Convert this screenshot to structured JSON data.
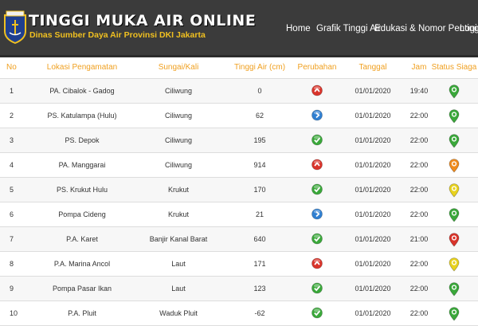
{
  "header": {
    "title": "TINGGI MUKA AIR ONLINE",
    "subtitle": "Dinas Sumber Daya Air Provinsi DKI Jakarta",
    "nav": [
      "Home",
      "Grafik Tinggi Air",
      "Edukasi & Nomor Penting",
      "Login"
    ]
  },
  "table": {
    "columns": [
      "No",
      "Lokasi Pengamatan",
      "Sungai/Kali",
      "Tinggi Air (cm)",
      "Perubahan",
      "Tanggal",
      "Jam",
      "Status Siaga"
    ],
    "rows": [
      {
        "no": "1",
        "lokasi": "PA. Cibalok - Gadog",
        "sungai": "Ciliwung",
        "tinggi": "0",
        "perubahan": "up",
        "tanggal": "01/01/2020",
        "jam": "19:40",
        "status": "normal"
      },
      {
        "no": "2",
        "lokasi": "PS. Katulampa (Hulu)",
        "sungai": "Ciliwung",
        "tinggi": "62",
        "perubahan": "steady",
        "tanggal": "01/01/2020",
        "jam": "22:00",
        "status": "normal"
      },
      {
        "no": "3",
        "lokasi": "PS. Depok",
        "sungai": "Ciliwung",
        "tinggi": "195",
        "perubahan": "down",
        "tanggal": "01/01/2020",
        "jam": "22:00",
        "status": "normal"
      },
      {
        "no": "4",
        "lokasi": "PA. Manggarai",
        "sungai": "Ciliwung",
        "tinggi": "914",
        "perubahan": "up",
        "tanggal": "01/01/2020",
        "jam": "22:00",
        "status": "siaga-2"
      },
      {
        "no": "5",
        "lokasi": "PS. Krukut Hulu",
        "sungai": "Krukut",
        "tinggi": "170",
        "perubahan": "down",
        "tanggal": "01/01/2020",
        "jam": "22:00",
        "status": "siaga-3"
      },
      {
        "no": "6",
        "lokasi": "Pompa Cideng",
        "sungai": "Krukut",
        "tinggi": "21",
        "perubahan": "steady",
        "tanggal": "01/01/2020",
        "jam": "22:00",
        "status": "normal"
      },
      {
        "no": "7",
        "lokasi": "P.A. Karet",
        "sungai": "Banjir Kanal Barat",
        "tinggi": "640",
        "perubahan": "down",
        "tanggal": "01/01/2020",
        "jam": "21:00",
        "status": "siaga-1"
      },
      {
        "no": "8",
        "lokasi": "P.A. Marina Ancol",
        "sungai": "Laut",
        "tinggi": "171",
        "perubahan": "up",
        "tanggal": "01/01/2020",
        "jam": "22:00",
        "status": "siaga-3"
      },
      {
        "no": "9",
        "lokasi": "Pompa Pasar Ikan",
        "sungai": "Laut",
        "tinggi": "123",
        "perubahan": "down",
        "tanggal": "01/01/2020",
        "jam": "22:00",
        "status": "normal"
      },
      {
        "no": "10",
        "lokasi": "P.A. Pluit",
        "sungai": "Waduk Pluit",
        "tinggi": "-62",
        "perubahan": "down",
        "tanggal": "01/01/2020",
        "jam": "22:00",
        "status": "normal"
      }
    ]
  },
  "icons": {
    "trend": {
      "up": {
        "icon": "chevron-up-icon",
        "color": "#d9342b"
      },
      "steady": {
        "icon": "chevron-right-icon",
        "color": "#2f7fd1"
      },
      "down": {
        "icon": "check-icon",
        "color": "#3aa83a"
      }
    },
    "status": {
      "normal": {
        "icon": "map-pin-icon",
        "color": "#3aa83a"
      },
      "siaga-3": {
        "icon": "map-pin-icon",
        "color": "#e8d21e"
      },
      "siaga-2": {
        "icon": "map-pin-icon",
        "color": "#f08c1e"
      },
      "siaga-1": {
        "icon": "map-pin-icon",
        "color": "#d9342b"
      }
    }
  },
  "colors": {
    "header_bg": "#3b3b3b",
    "accent": "#f0a020",
    "subtitle": "#f0c020"
  }
}
